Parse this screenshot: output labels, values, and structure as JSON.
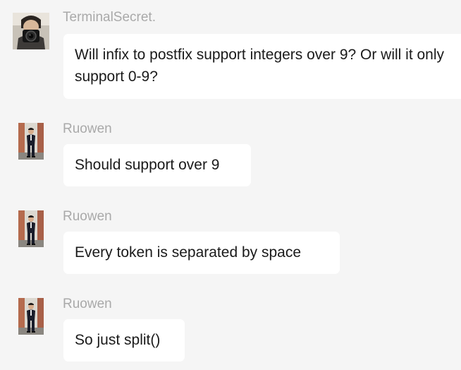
{
  "messages": [
    {
      "sender": "TerminalSecret.",
      "text": "Will infix to postfix support integers over 9? Or will it only support 0-9?",
      "avatar": "camera-photographer-avatar"
    },
    {
      "sender": "Ruowen",
      "text": "Should support over 9",
      "avatar": "person-standing-avatar"
    },
    {
      "sender": "Ruowen",
      "text": "Every token is separated by space",
      "avatar": "person-standing-avatar"
    },
    {
      "sender": "Ruowen",
      "text": "So just split()",
      "avatar": "person-standing-avatar"
    }
  ],
  "colors": {
    "background": "#f5f5f5",
    "bubble": "#ffffff",
    "sender": "#a9a9a9",
    "text": "#1a1a1a"
  }
}
